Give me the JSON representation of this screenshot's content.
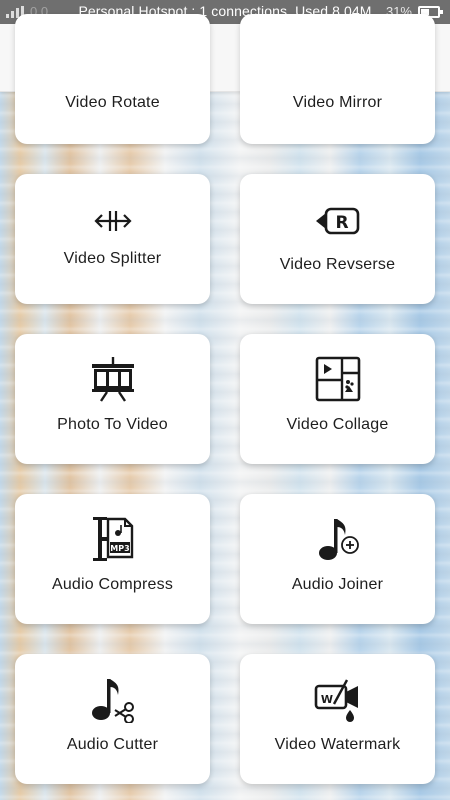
{
  "status_bar": {
    "hotspot_text": "Personal Hotspot : 1 connections, Used 8.04M",
    "background_text": "0.0",
    "battery_percent": "31%"
  },
  "tools": [
    {
      "label": "Video Rotate",
      "icon": "rotate-icon"
    },
    {
      "label": "Video Mirror",
      "icon": "mirror-icon"
    },
    {
      "label": "Video Splitter",
      "icon": "splitter-icon"
    },
    {
      "label": "Video Revserse",
      "icon": "reverse-icon"
    },
    {
      "label": "Photo To Video",
      "icon": "film-board-icon"
    },
    {
      "label": "Video Collage",
      "icon": "collage-icon"
    },
    {
      "label": "Audio Compress",
      "icon": "compress-mp3-icon"
    },
    {
      "label": "Audio Joiner",
      "icon": "music-note-plus-icon"
    },
    {
      "label": "Audio Cutter",
      "icon": "music-note-scissors-icon"
    },
    {
      "label": "Video Watermark",
      "icon": "watermark-camera-icon"
    }
  ],
  "icon_splitter_text": "R",
  "icon_mp3_text": "MP3",
  "icon_watermark_text": "W",
  "colors": {
    "status_bar": "#6f6f6f",
    "app_bar": "#f7f7f7",
    "card": "#ffffff",
    "icon": "#1a1a1a"
  }
}
